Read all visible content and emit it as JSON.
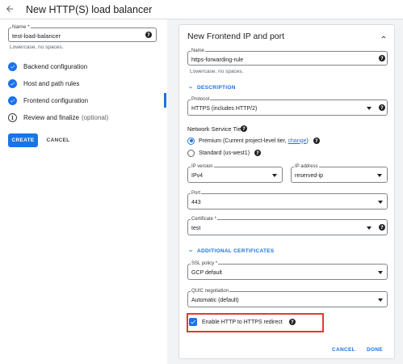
{
  "header": {
    "back_icon": "arrow-back-icon",
    "title": "New HTTP(S) load balancer"
  },
  "left": {
    "name_field": {
      "label": "Name *",
      "value": "test-load-balancer",
      "hint": "Lowercase, no spaces."
    },
    "steps": [
      {
        "label": "Backend configuration",
        "icon": "check-circle-icon",
        "status": "done"
      },
      {
        "label": "Host and path rules",
        "icon": "check-circle-icon",
        "status": "done"
      },
      {
        "label": "Frontend configuration",
        "icon": "check-circle-icon",
        "status": "active"
      },
      {
        "label": "Review and finalize",
        "optional": "(optional)",
        "icon": "info-icon",
        "status": "pending"
      }
    ],
    "create_label": "CREATE",
    "cancel_label": "CANCEL"
  },
  "card": {
    "title": "New Frontend IP and port",
    "name_field": {
      "label": "Name",
      "value": "https-forwarding-rule",
      "hint": "Lowercase, no spaces."
    },
    "description_toggle": "DESCRIPTION",
    "protocol": {
      "label": "Protocol",
      "value": "HTTPS (includes HTTP/2)"
    },
    "network_tier": {
      "label": "Network Service Tier",
      "premium": "Premium (Current project-level tier,",
      "premium_link": "change",
      "premium_close": ")",
      "standard": "Standard (us-west1)",
      "selected": "premium"
    },
    "ip_version": {
      "label": "IP version",
      "value": "IPv4"
    },
    "ip_address": {
      "label": "IP address",
      "value": "reserved-ip"
    },
    "port": {
      "label": "Port",
      "value": "443"
    },
    "certificate": {
      "label": "Certificate *",
      "value": "test"
    },
    "additional_toggle": "ADDITIONAL CERTIFICATES",
    "ssl_policy": {
      "label": "SSL policy *",
      "value": "GCP default"
    },
    "quic": {
      "label": "QUIC negotiation",
      "value": "Automatic (default)"
    },
    "redirect": {
      "label": "Enable HTTP to HTTPS redirect",
      "checked": true
    },
    "cancel_label": "CANCEL",
    "done_label": "DONE"
  },
  "colors": {
    "accent": "#1a73e8",
    "highlight": "#e53935",
    "panel_bg": "#f1f3f4"
  }
}
